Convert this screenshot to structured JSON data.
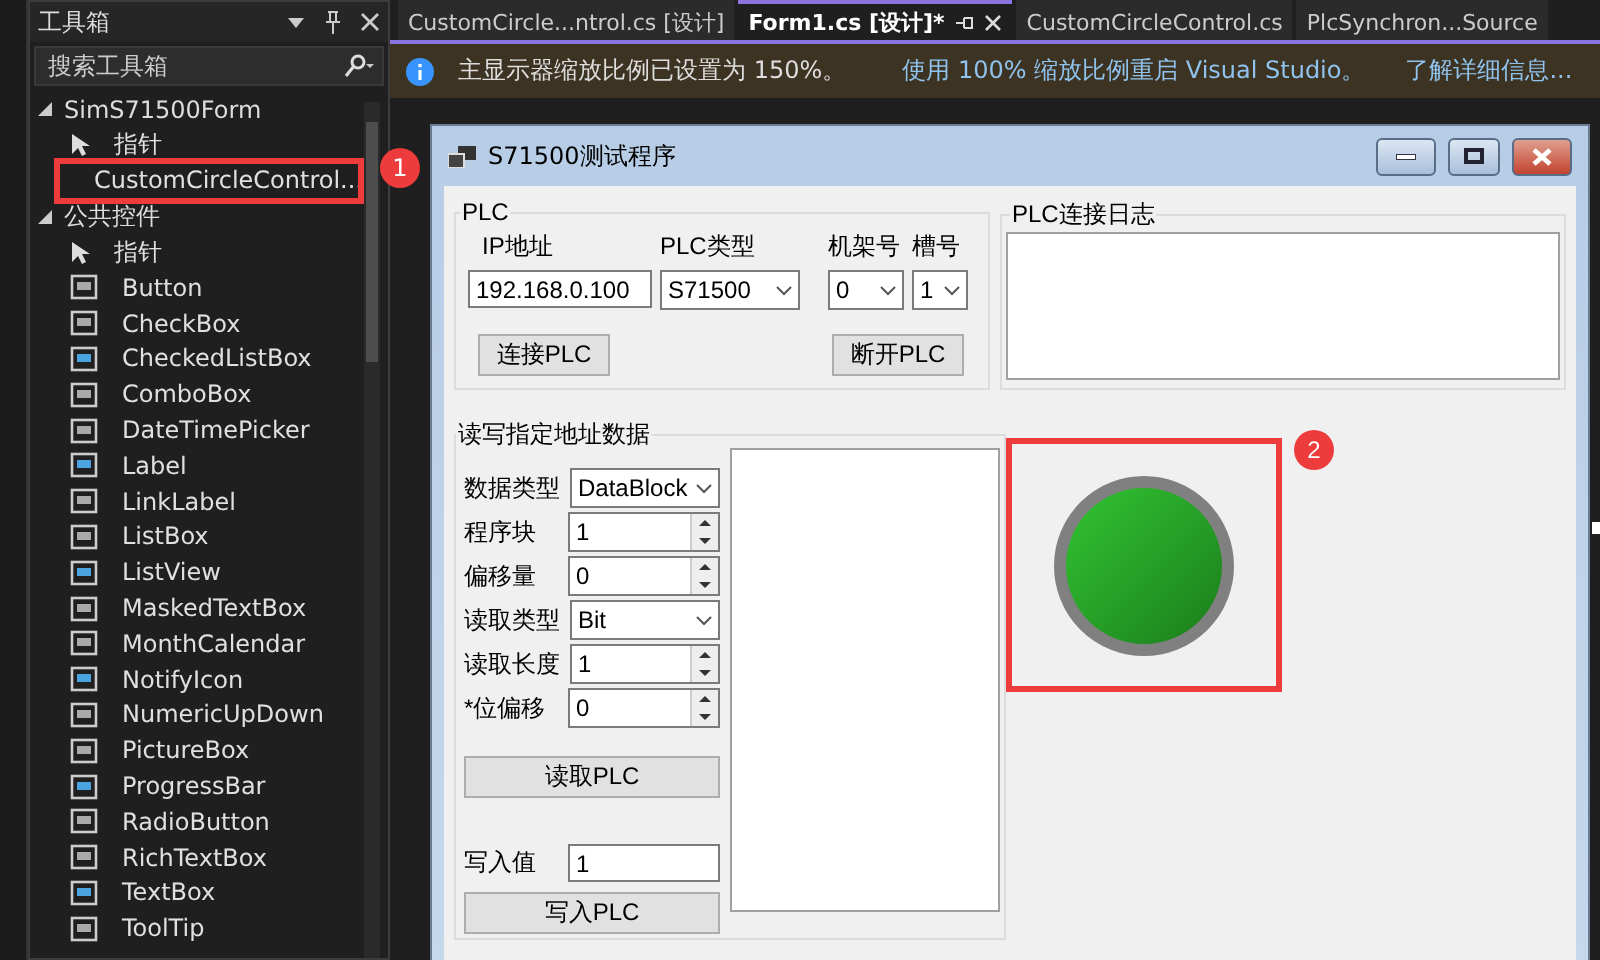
{
  "toolbox": {
    "title": "工具箱",
    "search": {
      "placeholder": "搜索工具箱"
    },
    "groups": [
      {
        "name": "SimS71500Form",
        "expanded": true,
        "items": [
          {
            "label": "指针"
          },
          {
            "label": "CustomCircleControl...",
            "marker": "1"
          }
        ]
      },
      {
        "name": "公共控件",
        "expanded": true,
        "items": [
          {
            "label": "指针"
          },
          {
            "label": "Button"
          },
          {
            "label": "CheckBox"
          },
          {
            "label": "CheckedListBox"
          },
          {
            "label": "ComboBox"
          },
          {
            "label": "DateTimePicker"
          },
          {
            "label": "Label"
          },
          {
            "label": "LinkLabel"
          },
          {
            "label": "ListBox"
          },
          {
            "label": "ListView"
          },
          {
            "label": "MaskedTextBox"
          },
          {
            "label": "MonthCalendar"
          },
          {
            "label": "NotifyIcon"
          },
          {
            "label": "NumericUpDown"
          },
          {
            "label": "PictureBox"
          },
          {
            "label": "ProgressBar"
          },
          {
            "label": "RadioButton"
          },
          {
            "label": "RichTextBox"
          },
          {
            "label": "TextBox"
          },
          {
            "label": "ToolTip"
          }
        ]
      }
    ]
  },
  "tabs": [
    {
      "label": "CustomCircle...ntrol.cs [设计]",
      "selected": false
    },
    {
      "label": "Form1.cs [设计]*",
      "selected": true
    },
    {
      "label": "CustomCircleControl.cs",
      "selected": false
    },
    {
      "label": "PlcSynchron...Source",
      "selected": false
    }
  ],
  "info_bar": {
    "message": "主显示器缩放比例已设置为 150%。",
    "links": [
      "使用 100% 缩放比例重启 Visual Studio。",
      "了解详细信息..."
    ]
  },
  "form": {
    "title": "S71500测试程序",
    "plc_group": {
      "title": "PLC",
      "ip_label": "IP地址",
      "ip_value": "192.168.0.100",
      "type_label": "PLC类型",
      "type_value": "S71500",
      "rack_label": "机架号",
      "rack_value": "0",
      "slot_label": "槽号",
      "slot_value": "1",
      "connect_button": "连接PLC",
      "disconnect_button": "断开PLC"
    },
    "log_group": {
      "title": "PLC连接日志"
    },
    "rw_group": {
      "title": "读写指定地址数据",
      "rows": [
        {
          "label": "数据类型",
          "kind": "combo",
          "value": "DataBlock"
        },
        {
          "label": "程序块",
          "kind": "spin",
          "value": "1"
        },
        {
          "label": "偏移量",
          "kind": "spin",
          "value": "0"
        },
        {
          "label": "读取类型",
          "kind": "combo",
          "value": "Bit"
        },
        {
          "label": "读取长度",
          "kind": "spin",
          "value": "1"
        },
        {
          "label": "*位偏移",
          "kind": "spin",
          "value": "0"
        }
      ],
      "read_button": "读取PLC",
      "write_label": "写入值",
      "write_value": "1",
      "write_button": "写入PLC"
    },
    "lamp": {
      "on": true,
      "marker": "2"
    }
  }
}
